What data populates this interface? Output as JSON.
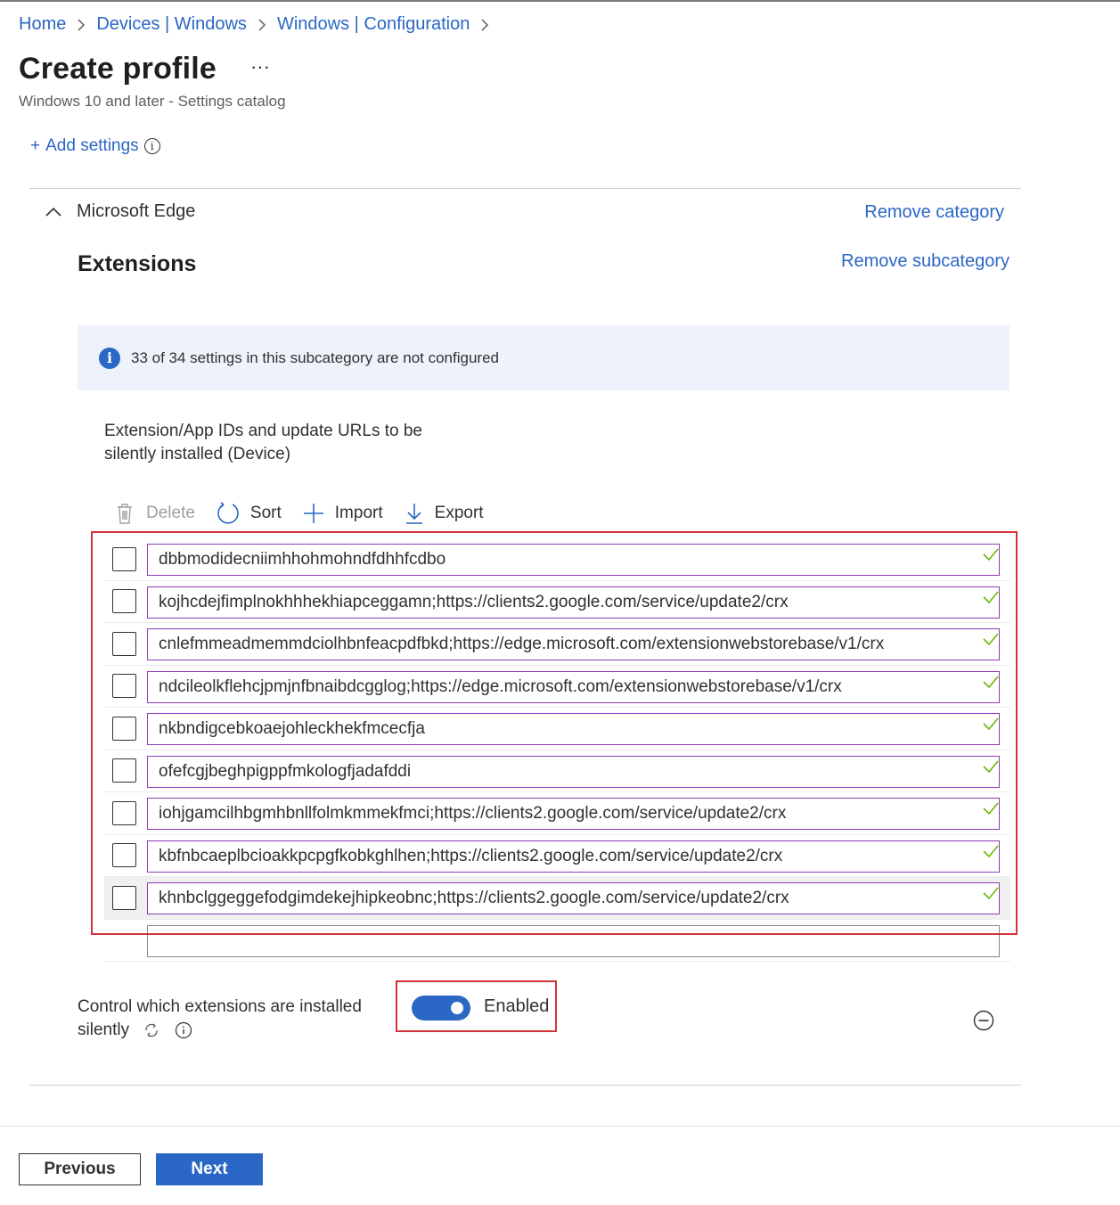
{
  "breadcrumb": {
    "items": [
      "Home",
      "Devices | Windows",
      "Windows | Configuration"
    ]
  },
  "header": {
    "title": "Create profile",
    "more": "···",
    "subtitle": "Windows 10 and later - Settings catalog"
  },
  "add_settings": {
    "plus": "+",
    "label": "Add settings",
    "info": "i"
  },
  "category": {
    "name": "Microsoft Edge",
    "remove_label": "Remove category"
  },
  "subcategory": {
    "title": "Extensions",
    "remove_label": "Remove subcategory"
  },
  "info_bar": {
    "icon": "i",
    "text": "33 of 34 settings in this subcategory are not configured"
  },
  "setting": {
    "label": "Extension/App IDs and update URLs to be silently installed (Device)"
  },
  "toolbar": {
    "delete": "Delete",
    "sort": "Sort",
    "import": "Import",
    "export": "Export"
  },
  "list": {
    "items": [
      "dbbmodidecniimhhohmohndfdhhfcdbo",
      "kojhcdejfimplnokhhhekhiapceggamn;https://clients2.google.com/service/update2/crx",
      "cnlefmmeadmemmdciolhbnfeacpdfbkd;https://edge.microsoft.com/extensionwebstorebase/v1/crx",
      "ndcileolkflehcjpmjnfbnaibdcgglog;https://edge.microsoft.com/extensionwebstorebase/v1/crx",
      "nkbndigcebkoaejohleckhekfmcecfja",
      "ofefcgjbeghpigppfmkologfjadafddi",
      "iohjgamcilhbgmhbnllfolmkmmekfmci;https://clients2.google.com/service/update2/crx",
      "kbfnbcaeplbcioakkpcpgfkobkghlhen;https://clients2.google.com/service/update2/crx",
      "khnbclggeggefodgimdekejhipkeobnc;https://clients2.google.com/service/update2/crx"
    ],
    "new_item_value": ""
  },
  "control_setting": {
    "label": "Control which extensions are installed silently",
    "toggle_state": "Enabled",
    "enabled": true
  },
  "footer": {
    "previous": "Previous",
    "next": "Next"
  },
  "colors": {
    "link": "#2b67c4",
    "highlight_box": "#d13438",
    "field_border": "#8f3bb8",
    "valid_check": "#6bb700",
    "info_bar_bg": "#eef3fb"
  }
}
